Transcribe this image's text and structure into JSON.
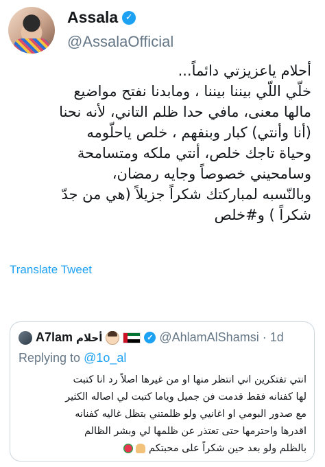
{
  "tweet": {
    "display_name": "Assala",
    "handle": "@AssalaOfficial",
    "verified_icon": "verified-badge-icon",
    "lines": [
      "أحلام ياعزيزتي دائماً...",
      "خلّي اللّي بيننا بيننا ، ومابدنا نفتح مواضيع",
      "مالها معنى، مافي حدا ظلم التاني، لأنه نحنا",
      "(أنا وأنتي) كبار وبنفهم ، خلص ياحلّومه",
      "وحياة تاجك خلص، أنتي ملكه ومتسامحة",
      "وسامحيني خصوصاً وجايه رمضان،",
      "وبالنّسبه لمباركتك شكراً جزيلاً (هي من جدّ",
      "شكراً ) و#خلص"
    ],
    "translate_label": "Translate Tweet"
  },
  "quoted_tweet": {
    "name": "A7lam",
    "name_arabic": "أحلام",
    "handle": "@AhlamAlShamsi",
    "separator": "·",
    "time": "1d",
    "replying_to_prefix": "Replying to",
    "replying_to_handle": "@1o_al",
    "lines": [
      "انتي تفتكرين اني انتظر منها او من غيرها اصلاً رد انا كتبت",
      "لها كفنانه فقط قدمت فن جميل وياما كتبت لي اصاله الكثير",
      "مع صدور البومي او اغانيي ولو ظلمتني بتظل غاليه كفنانه",
      "اقدرها واحترمها حتى تعتذر عن ظلمها لي وبشر الظالم",
      "بالظلم ولو بعد حين شكراً على محبتكم"
    ],
    "emoji_icons": [
      "folded-hands-icon",
      "rose-icon"
    ],
    "flag_colors": {
      "red": "#ce1126",
      "green": "#00732f",
      "white": "#ffffff",
      "black": "#000000"
    }
  },
  "colors": {
    "accent": "#1da1f2",
    "secondary_text": "#657786",
    "border": "#ccd6dd"
  }
}
